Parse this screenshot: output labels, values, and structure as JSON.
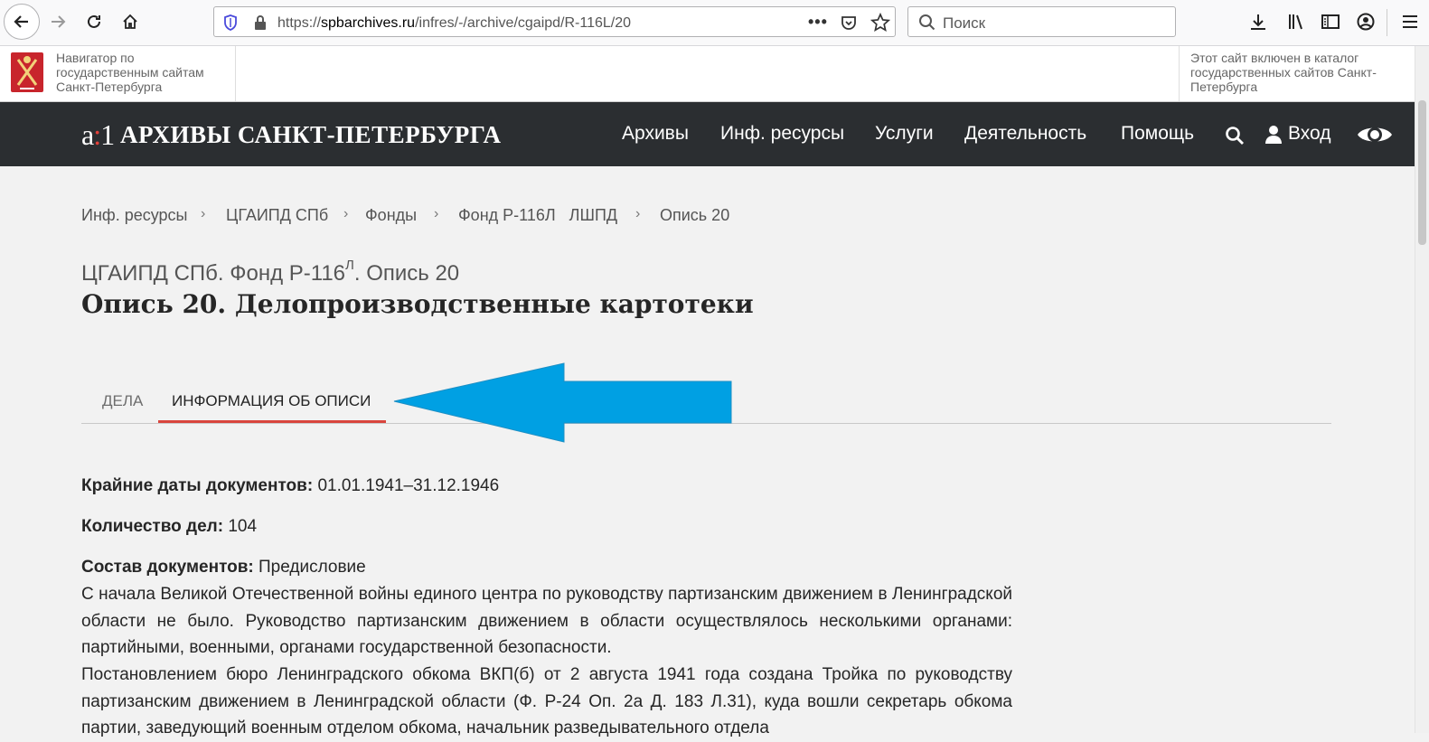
{
  "browser": {
    "url_prefix": "https://",
    "url_domain": "spbarchives.ru",
    "url_path": "/infres/-/archive/cgaipd/R-116L/20",
    "search_placeholder": "Поиск"
  },
  "gov_strip": {
    "left_text": "Навигатор по государственным сайтам Санкт-Петербурга",
    "right_text": "Этот сайт включен в каталог государственных сайтов Санкт-Петербурга"
  },
  "header": {
    "logo_a": "a",
    "logo_sep": ":",
    "logo_1": "1",
    "site_title": "АРХИВЫ САНКТ-ПЕТЕРБУРГА",
    "nav": {
      "archives": "Архивы",
      "infres": "Инф. ресурсы",
      "services": "Услуги",
      "activity": "Деятельность",
      "help": "Помощь",
      "login": "Вход"
    }
  },
  "breadcrumb": [
    "Инф. ресурсы",
    "ЦГАИПД СПб",
    "Фонды",
    "Фонд Р-116Л   ЛШПД",
    "Опись 20"
  ],
  "page": {
    "subtitle_pre": "ЦГАИПД СПб. Фонд Р-116",
    "subtitle_sup": "Л",
    "subtitle_post": ". Опись 20",
    "title": "Опись 20. Делопроизводственные картотеки"
  },
  "tabs": {
    "cases": "ДЕЛА",
    "info": "ИНФОРМАЦИЯ ОБ ОПИСИ"
  },
  "details": {
    "dates_label": "Крайние даты документов:",
    "dates_value": "01.01.1941–31.12.1946",
    "count_label": "Количество дел:",
    "count_value": "104",
    "composition_label": "Состав документов:",
    "composition_value": "Предисловие",
    "paragraph1": "С начала Великой Отечественной войны единого центра по руководству партизанским движением в Ленинградской области не было. Руководство партизанским движением в области осуществлялось несколькими органами: партийными, военными, органами государственной безопасности.",
    "paragraph2": "Постановлением бюро Ленинградского обкома ВКП(б) от 2 августа 1941 года создана Тройка по руководству партизанским движением в Ленинградской области (Ф. Р-24 Оп. 2а Д. 183 Л.31), куда вошли секретарь обкома партии, заведующий военным отделом обкома, начальник разведывательного отдела"
  },
  "colors": {
    "header_bg": "#2b2e31",
    "accent_red": "#d9453d",
    "arrow_blue": "#00a0e3",
    "page_bg": "#f2f2f2"
  }
}
